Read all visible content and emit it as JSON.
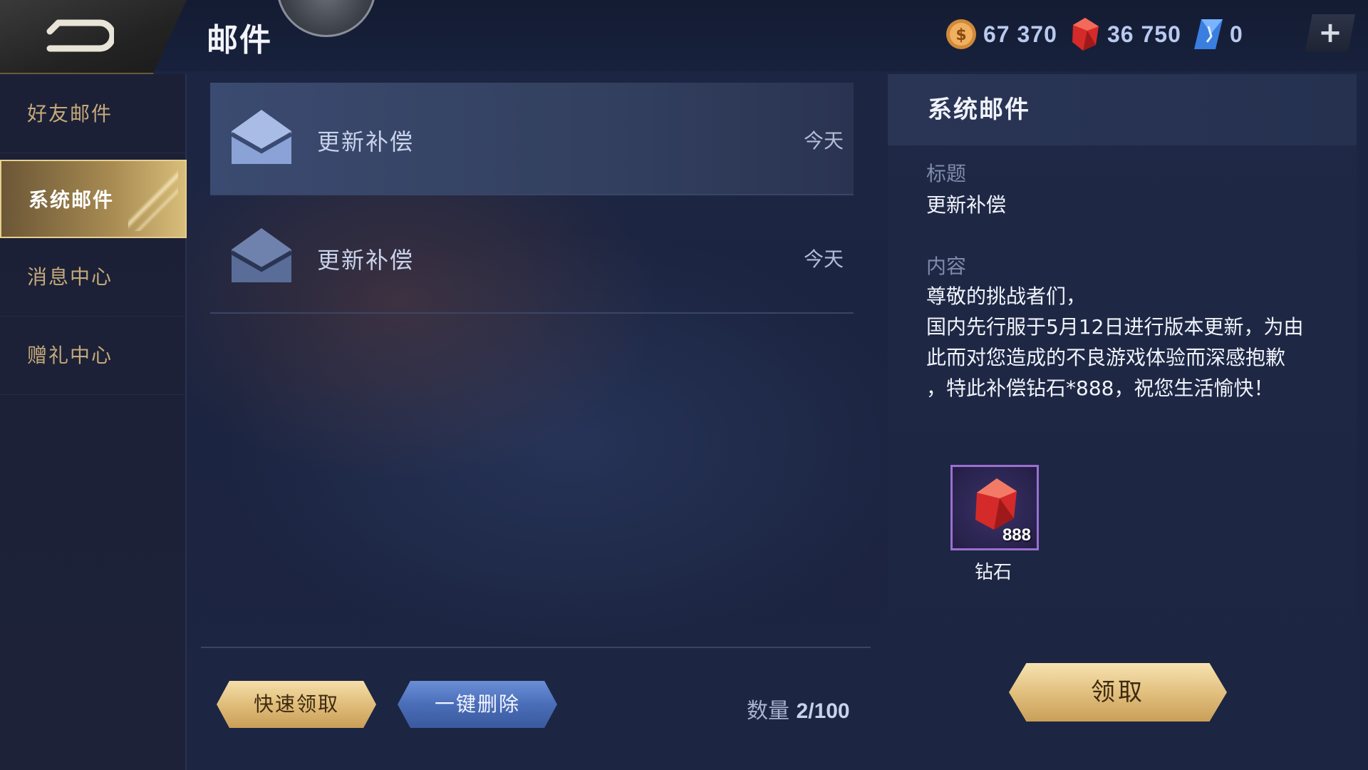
{
  "header": {
    "title": "邮件",
    "back_icon": "back-arrow-icon",
    "currencies": [
      {
        "icon": "gold-coin-icon",
        "value": "67 370",
        "color": "#e0a050"
      },
      {
        "icon": "red-diamond-icon",
        "value": "36 750",
        "color": "#e03a3a"
      },
      {
        "icon": "blue-crystal-icon",
        "value": "0",
        "color": "#4a8ff0"
      }
    ],
    "plus_label": "+"
  },
  "sidebar": {
    "items": [
      {
        "label": "好友邮件",
        "active": false
      },
      {
        "label": "系统邮件",
        "active": true
      },
      {
        "label": "消息中心",
        "active": false
      },
      {
        "label": "赠礼中心",
        "active": false
      }
    ]
  },
  "mail_list": {
    "items": [
      {
        "subject": "更新补偿",
        "date": "今天",
        "selected": true,
        "icon": "envelope-icon"
      },
      {
        "subject": "更新补偿",
        "date": "今天",
        "selected": false,
        "icon": "envelope-icon"
      }
    ],
    "quick_claim_label": "快速领取",
    "delete_all_label": "一键删除",
    "count_label": "数量",
    "count_value": "2/100"
  },
  "detail": {
    "header": "系统邮件",
    "title_label": "标题",
    "title_value": "更新补偿",
    "content_label": "内容",
    "content_lines": [
      "尊敬的挑战者们，",
      "国内先行服于5月12日进行版本更新，为由",
      "此而对您造成的不良游戏体验而深感抱歉",
      "，特此补偿钻石*888，祝您生活愉快！"
    ],
    "reward": {
      "name": "钻石",
      "quantity": "888",
      "icon": "red-diamond-icon"
    },
    "claim_label": "领取"
  },
  "colors": {
    "gold_accent": "#e0bd7a",
    "blue_button": "#4a6db8",
    "panel_bg": "#1f2946"
  }
}
